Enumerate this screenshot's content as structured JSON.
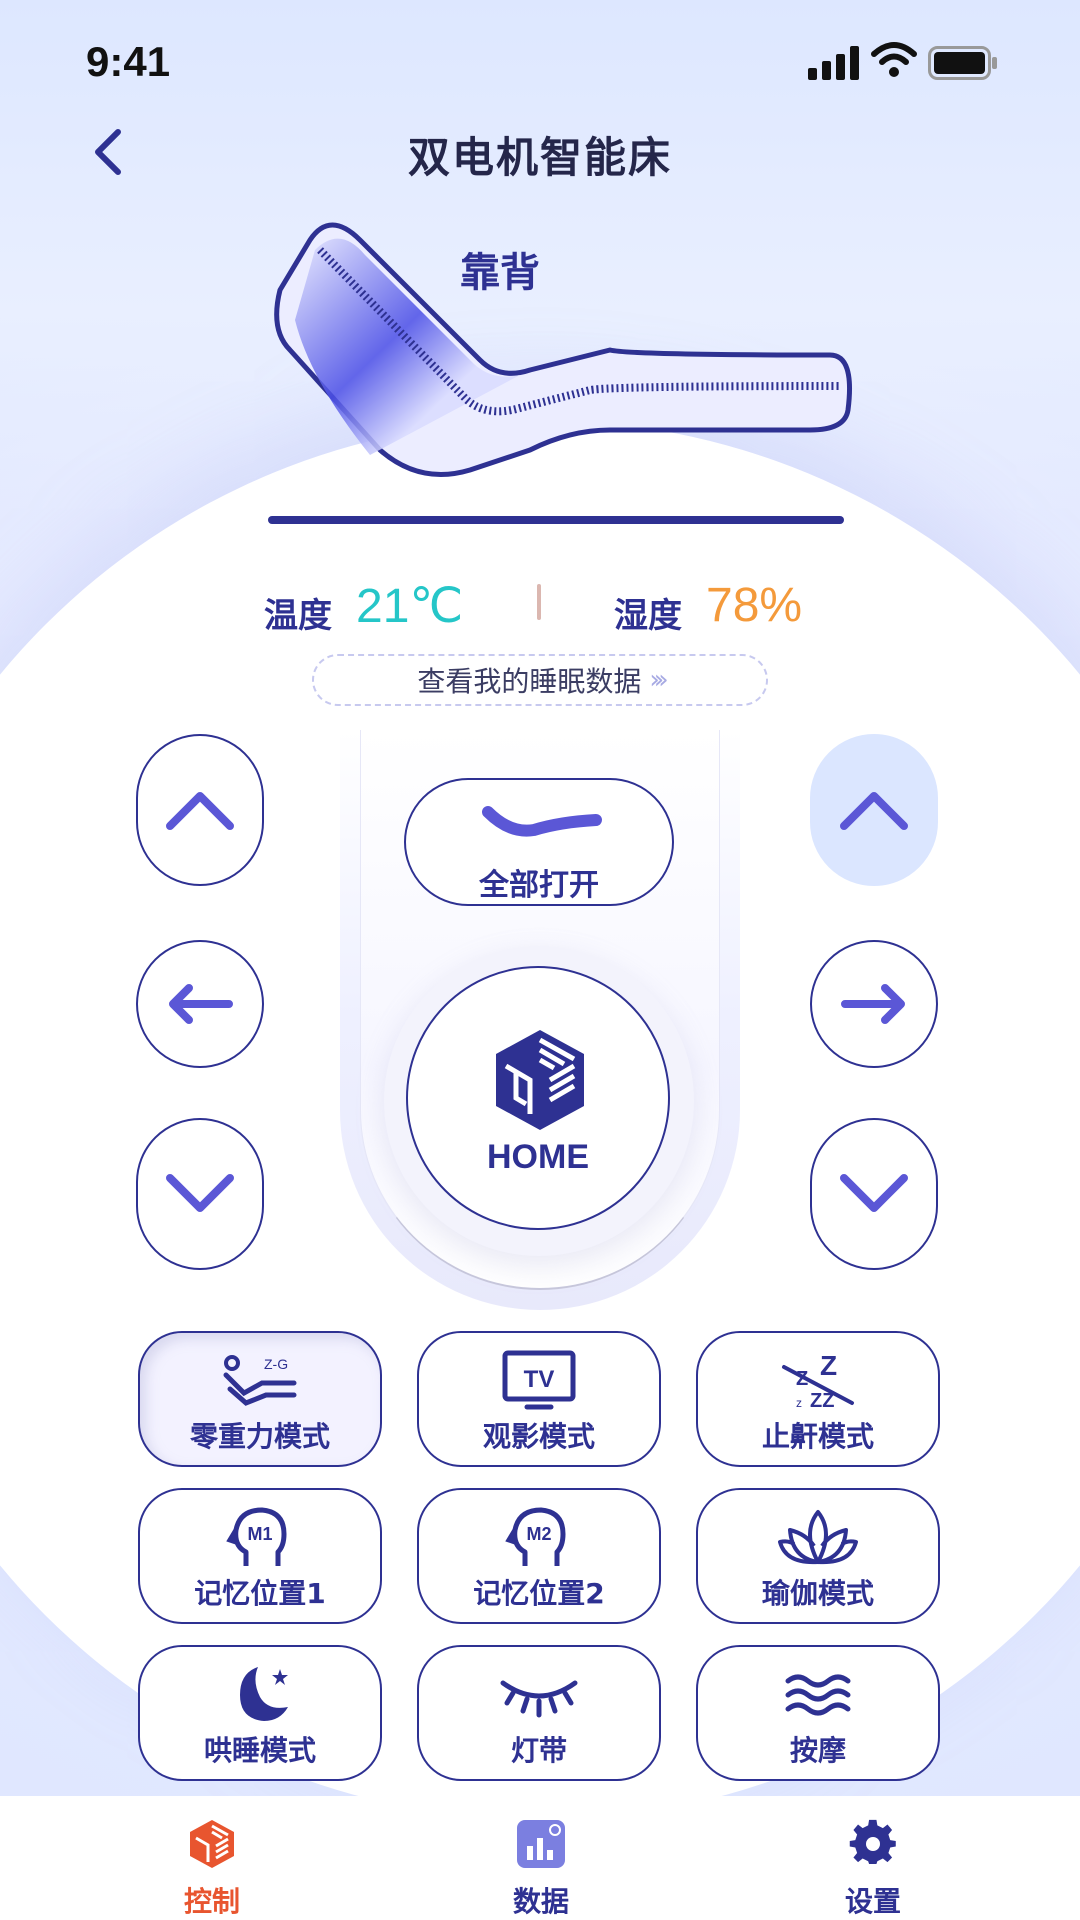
{
  "status_bar": {
    "time": "9:41"
  },
  "header": {
    "title": "双电机智能床"
  },
  "bed": {
    "section_label": "靠背"
  },
  "environment": {
    "temperature_label": "温度",
    "temperature_value": "21℃",
    "humidity_label": "湿度",
    "humidity_value": "78%"
  },
  "sleep_link": {
    "label": "查看我的睡眠数据",
    "chevrons": "›››"
  },
  "center": {
    "open_all_label": "全部打开",
    "home_label": "HOME"
  },
  "modes": [
    {
      "label": "零重力模式",
      "icon": "zero-gravity-icon",
      "tag": "Z-G"
    },
    {
      "label": "观影模式",
      "icon": "tv-icon",
      "tag": "TV"
    },
    {
      "label": "止鼾模式",
      "icon": "anti-snore-icon"
    },
    {
      "label": "记忆位置1",
      "icon": "memory-1-icon",
      "tag": "M1"
    },
    {
      "label": "记忆位置2",
      "icon": "memory-2-icon",
      "tag": "M2"
    },
    {
      "label": "瑜伽模式",
      "icon": "lotus-icon"
    },
    {
      "label": "哄睡模式",
      "icon": "moon-icon"
    },
    {
      "label": "灯带",
      "icon": "eyelash-icon"
    },
    {
      "label": "按摩",
      "icon": "waves-icon"
    }
  ],
  "tabbar": [
    {
      "label": "控制",
      "icon": "control-icon",
      "color": "#e8552f"
    },
    {
      "label": "数据",
      "icon": "data-icon",
      "color": "#2e3192"
    },
    {
      "label": "设置",
      "icon": "gear-icon",
      "color": "#2e3192"
    }
  ],
  "colors": {
    "primary": "#2e3192",
    "accent_cyan": "#25c6c8",
    "accent_orange": "#f49a3b",
    "active_tab": "#e8552f"
  }
}
